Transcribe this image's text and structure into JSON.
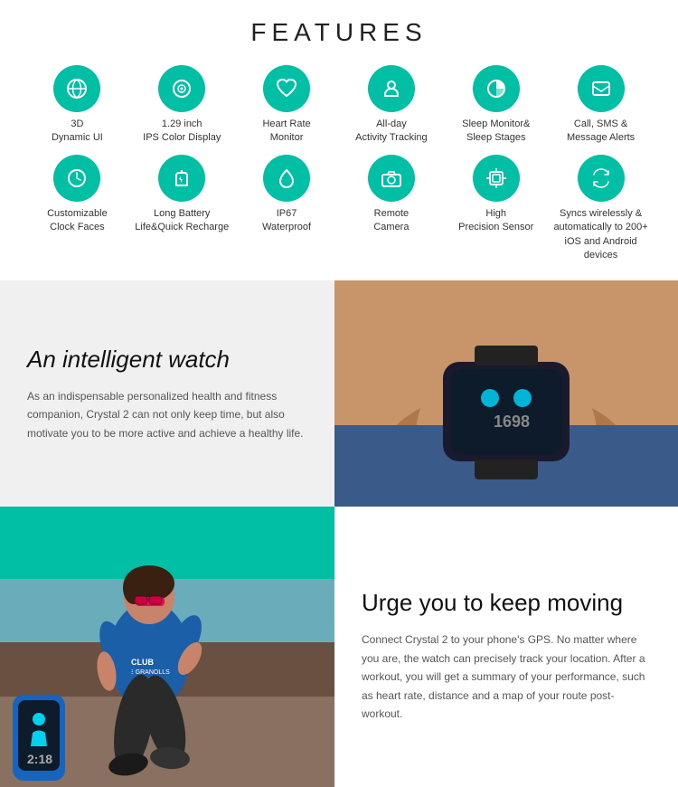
{
  "page": {
    "features_title": "FEATURES",
    "features": [
      {
        "id": "dynamic-ui",
        "icon": "↻",
        "label": "3D\nDynamic UI",
        "icon_symbol": "3d"
      },
      {
        "id": "ips-display",
        "icon": "◉",
        "label": "1.29 inch\nIPS Color Display",
        "icon_symbol": "eye"
      },
      {
        "id": "heart-rate",
        "icon": "♥",
        "label": "Heart Rate\nMonitor",
        "icon_symbol": "heart"
      },
      {
        "id": "activity-tracking",
        "icon": "📍",
        "label": "All-day\nActivity Tracking",
        "icon_symbol": "pin"
      },
      {
        "id": "sleep-monitor",
        "icon": "◔",
        "label": "Sleep Monitor&\nSleep Stages",
        "icon_symbol": "pie"
      },
      {
        "id": "call-sms",
        "icon": "✉",
        "label": "Call, SMS &\nMessage Alerts",
        "icon_symbol": "message"
      },
      {
        "id": "clock-faces",
        "icon": "🕐",
        "label": "Customizable\nClock Faces",
        "icon_symbol": "clock"
      },
      {
        "id": "battery",
        "icon": "⚡",
        "label": "Long Battery\nLife&Quick Recharge",
        "icon_symbol": "bolt"
      },
      {
        "id": "waterproof",
        "icon": "💧",
        "label": "IP67\nWaterproof",
        "icon_symbol": "drop"
      },
      {
        "id": "camera",
        "icon": "📷",
        "label": "Remote\nCamera",
        "icon_symbol": "camera"
      },
      {
        "id": "sensor",
        "icon": "⬡",
        "label": "High\nPrecision Sensor",
        "icon_symbol": "hexagon"
      },
      {
        "id": "sync",
        "icon": "⇄",
        "label": "Syncs wirelessly &\nautomatically to 200+\niOS and Android devices",
        "icon_symbol": "sync"
      }
    ],
    "intelligent_section": {
      "heading": "An intelligent watch",
      "body": "As an indispensable personalized health and fitness companion, Crystal 2 can not only keep time, but also motivate you to be more active and achieve a healthy life."
    },
    "moving_section": {
      "heading": "Urge you to keep moving",
      "body": "Connect Crystal 2 to your phone's GPS. No matter where you are, the watch can precisely track your location. After a workout, you will get a summary of your performance, such as heart rate, distance and a map of your route post-workout."
    },
    "watch_time": "1698",
    "band_time": "2:18",
    "icon_color": "#00bfa5"
  }
}
